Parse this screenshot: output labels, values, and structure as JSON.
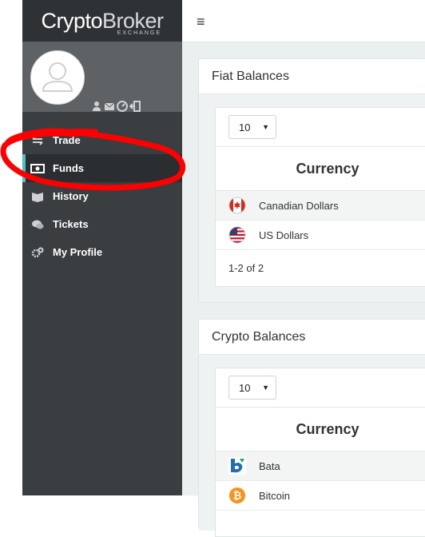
{
  "brand": {
    "name_bold": "Crypto",
    "name_light": "Broker",
    "sub": "EXCHANGE"
  },
  "topbar": {
    "menu_icon": "≡"
  },
  "sidebar": {
    "user_icons": [
      "user-icon",
      "envelope-icon",
      "dashboard-icon",
      "logout-icon"
    ],
    "items": [
      {
        "label": "Trade",
        "icon": "arrows-icon",
        "active": false
      },
      {
        "label": "Funds",
        "icon": "money-icon",
        "active": true
      },
      {
        "label": "History",
        "icon": "book-icon",
        "active": false
      },
      {
        "label": "Tickets",
        "icon": "chat-icon",
        "active": false
      },
      {
        "label": "My Profile",
        "icon": "cogs-icon",
        "active": false
      }
    ]
  },
  "fiat": {
    "title": "Fiat Balances",
    "page_size": "10",
    "column": "Currency",
    "rows": [
      {
        "name": "Canadian Dollars",
        "flag": "canada-flag-icon"
      },
      {
        "name": "US Dollars",
        "flag": "usa-flag-icon"
      }
    ],
    "pagination": "1-2 of 2"
  },
  "crypto": {
    "title": "Crypto Balances",
    "page_size": "10",
    "column": "Currency",
    "rows": [
      {
        "name": "Bata",
        "icon": "bata-icon"
      },
      {
        "name": "Bitcoin",
        "icon": "bitcoin-icon"
      }
    ]
  },
  "colors": {
    "accent": "#4bbfc8",
    "sidebar": "#3b3e40",
    "annotation": "#ff0000"
  }
}
